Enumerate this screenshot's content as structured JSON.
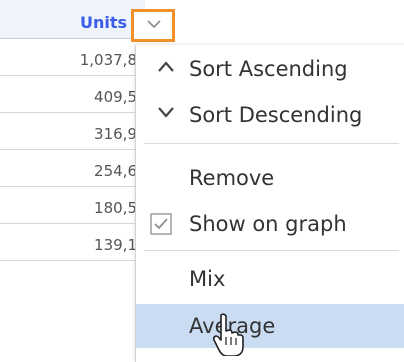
{
  "column": {
    "title": "Units",
    "values": [
      "1,037,8",
      "409,5",
      "316,9",
      "254,6",
      "180,5",
      "139,1"
    ]
  },
  "dropdown_toggle": {
    "icon": "chevron-down-icon"
  },
  "menu": {
    "sort_ascending": "Sort Ascending",
    "sort_descending": "Sort Descending",
    "remove": "Remove",
    "show_on_graph": "Show on graph",
    "show_on_graph_checked": true,
    "mix": "Mix",
    "average": "Average"
  },
  "colors": {
    "header_bg": "#eef3fc",
    "title_blue": "#3a5ce6",
    "toggle_border": "#f0912a",
    "hover_bg": "#c9dcf2"
  }
}
